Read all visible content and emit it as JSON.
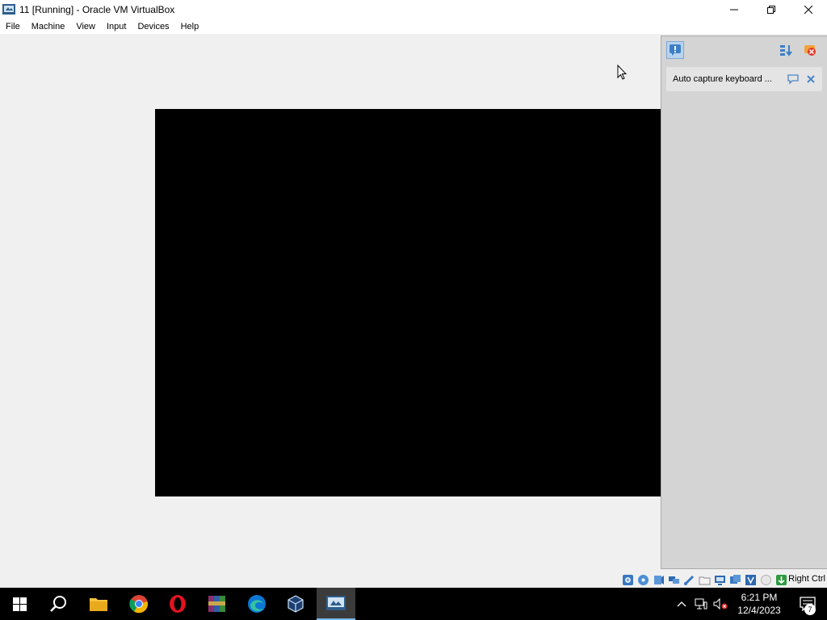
{
  "window": {
    "title": "11 [Running] - Oracle VM VirtualBox"
  },
  "menu": {
    "items": [
      "File",
      "Machine",
      "View",
      "Input",
      "Devices",
      "Help"
    ]
  },
  "notification_panel": {
    "item_text": "Auto capture keyboard ..."
  },
  "statusbar": {
    "host_key": "Right Ctrl",
    "icons": [
      "hard-disk-icon",
      "optical-drive-icon",
      "audio-icon",
      "network-icon",
      "usb-icon",
      "shared-folders-icon",
      "display-icon",
      "recording-icon",
      "cpu-icon",
      "mouse-integration-icon",
      "keyboard-icon"
    ]
  },
  "taskbar": {
    "apps": [
      "file-explorer",
      "chrome",
      "opera",
      "winrar",
      "edge",
      "virtualbox-manager",
      "virtualbox-vm"
    ],
    "clock_time": "6:21 PM",
    "clock_date": "12/4/2023",
    "notification_count": "7"
  },
  "colors": {
    "titlebar": "#ffffff",
    "background": "#f0f0f0",
    "vm_screen": "#000000",
    "taskbar": "#000000",
    "accent": "#76b9ed"
  }
}
